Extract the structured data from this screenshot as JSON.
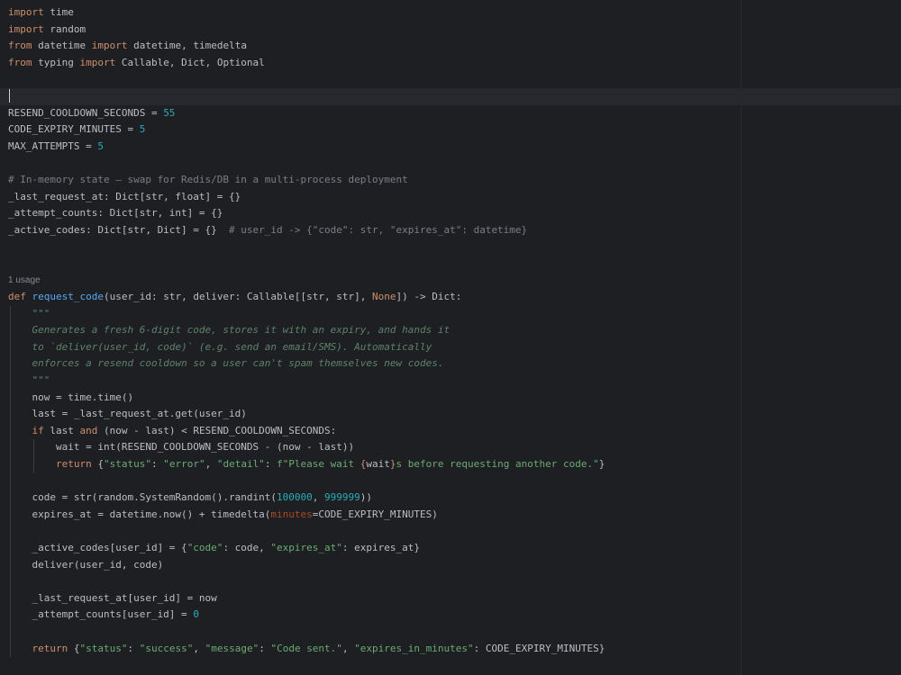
{
  "editor": {
    "language": "python",
    "theme_colors": {
      "background": "#1e1f22",
      "text": "#bcbec4",
      "keyword": "#cf8e6d",
      "number": "#2aacb8",
      "string": "#6aab73",
      "comment": "#7a7e85",
      "docstring": "#5f826b",
      "function_def": "#56a8f5",
      "named_argument": "#aa4926",
      "current_line": "#26282e",
      "usage_hint": "#868a91"
    },
    "usage_hint": "1 usage",
    "lines": [
      [
        {
          "type": "keyword",
          "text": "import"
        },
        {
          "type": "plain",
          "text": " time"
        }
      ],
      [
        {
          "type": "keyword",
          "text": "import"
        },
        {
          "type": "plain",
          "text": " random"
        }
      ],
      [
        {
          "type": "keyword",
          "text": "from"
        },
        {
          "type": "plain",
          "text": " datetime "
        },
        {
          "type": "keyword",
          "text": "import"
        },
        {
          "type": "plain",
          "text": " datetime, timedelta"
        }
      ],
      [
        {
          "type": "keyword",
          "text": "from"
        },
        {
          "type": "plain",
          "text": " typing "
        },
        {
          "type": "keyword",
          "text": "import"
        },
        {
          "type": "plain",
          "text": " Callable, Dict, Optional"
        }
      ],
      [],
      [
        {
          "type": "caret",
          "text": ""
        }
      ],
      [
        {
          "type": "plain",
          "text": "RESEND_COOLDOWN_SECONDS = "
        },
        {
          "type": "number",
          "text": "55"
        }
      ],
      [
        {
          "type": "plain",
          "text": "CODE_EXPIRY_MINUTES = "
        },
        {
          "type": "number",
          "text": "5"
        }
      ],
      [
        {
          "type": "plain",
          "text": "MAX_ATTEMPTS = "
        },
        {
          "type": "number",
          "text": "5"
        }
      ],
      [],
      [
        {
          "type": "comment",
          "text": "# In-memory state — swap for Redis/DB in a multi-process deployment"
        }
      ],
      [
        {
          "type": "plain",
          "text": "_last_request_at: Dict[str, float] = {}"
        }
      ],
      [
        {
          "type": "plain",
          "text": "_attempt_counts: Dict[str, int] = {}"
        }
      ],
      [
        {
          "type": "plain",
          "text": "_active_codes: Dict[str, Dict] = {}  "
        },
        {
          "type": "comment",
          "text": "# user_id -> {\"code\": str, \"expires_at\": datetime}"
        }
      ],
      [],
      [],
      [
        {
          "type": "hint",
          "text": "1 usage"
        }
      ],
      [
        {
          "type": "keyword",
          "text": "def"
        },
        {
          "type": "plain",
          "text": " "
        },
        {
          "type": "func-def",
          "text": "request_code"
        },
        {
          "type": "plain",
          "text": "(user_id: str, deliver: Callable[[str, str], "
        },
        {
          "type": "keyword",
          "text": "None"
        },
        {
          "type": "plain",
          "text": "]) -> Dict:"
        }
      ],
      [
        {
          "type": "plain",
          "text": "    "
        },
        {
          "type": "doc",
          "text": "\"\"\""
        }
      ],
      [
        {
          "type": "plain",
          "text": "    "
        },
        {
          "type": "doc",
          "text": "Generates a fresh 6-digit code, stores it with an expiry, and hands it"
        }
      ],
      [
        {
          "type": "plain",
          "text": "    "
        },
        {
          "type": "doc",
          "text": "to `deliver(user_id, code)` (e.g. send an email/SMS). Automatically"
        }
      ],
      [
        {
          "type": "plain",
          "text": "    "
        },
        {
          "type": "doc",
          "text": "enforces a resend cooldown so a user can't spam themselves new codes."
        }
      ],
      [
        {
          "type": "plain",
          "text": "    "
        },
        {
          "type": "doc",
          "text": "\"\"\""
        }
      ],
      [
        {
          "type": "plain",
          "text": "    now = time.time()"
        }
      ],
      [
        {
          "type": "plain",
          "text": "    last = _last_request_at.get(user_id)"
        }
      ],
      [
        {
          "type": "plain",
          "text": "    "
        },
        {
          "type": "keyword",
          "text": "if"
        },
        {
          "type": "plain",
          "text": " last "
        },
        {
          "type": "keyword",
          "text": "and"
        },
        {
          "type": "plain",
          "text": " (now - last) < RESEND_COOLDOWN_SECONDS:"
        }
      ],
      [
        {
          "type": "plain",
          "text": "        wait = int(RESEND_COOLDOWN_SECONDS - (now - last))"
        }
      ],
      [
        {
          "type": "plain",
          "text": "        "
        },
        {
          "type": "keyword",
          "text": "return"
        },
        {
          "type": "plain",
          "text": " {"
        },
        {
          "type": "string",
          "text": "\"status\""
        },
        {
          "type": "plain",
          "text": ": "
        },
        {
          "type": "string",
          "text": "\"error\""
        },
        {
          "type": "plain",
          "text": ", "
        },
        {
          "type": "string",
          "text": "\"detail\""
        },
        {
          "type": "plain",
          "text": ": "
        },
        {
          "type": "string",
          "text": "f\"Please wait "
        },
        {
          "type": "fstring-brace",
          "text": "{"
        },
        {
          "type": "plain",
          "text": "wait"
        },
        {
          "type": "fstring-brace",
          "text": "}"
        },
        {
          "type": "string",
          "text": "s before requesting another code.\""
        },
        {
          "type": "plain",
          "text": "}"
        }
      ],
      [],
      [
        {
          "type": "plain",
          "text": "    code = str(random.SystemRandom().randint("
        },
        {
          "type": "number",
          "text": "100000"
        },
        {
          "type": "plain",
          "text": ", "
        },
        {
          "type": "number",
          "text": "999999"
        },
        {
          "type": "plain",
          "text": "))"
        }
      ],
      [
        {
          "type": "plain",
          "text": "    expires_at = datetime.now() + timedelta("
        },
        {
          "type": "param",
          "text": "minutes"
        },
        {
          "type": "plain",
          "text": "=CODE_EXPIRY_MINUTES)"
        }
      ],
      [],
      [
        {
          "type": "plain",
          "text": "    _active_codes[user_id] = {"
        },
        {
          "type": "string",
          "text": "\"code\""
        },
        {
          "type": "plain",
          "text": ": code, "
        },
        {
          "type": "string",
          "text": "\"expires_at\""
        },
        {
          "type": "plain",
          "text": ": expires_at}"
        }
      ],
      [
        {
          "type": "plain",
          "text": "    deliver(user_id, code)"
        }
      ],
      [],
      [
        {
          "type": "plain",
          "text": "    _last_request_at[user_id] = now"
        }
      ],
      [
        {
          "type": "plain",
          "text": "    _attempt_counts[user_id] = "
        },
        {
          "type": "number",
          "text": "0"
        }
      ],
      [],
      [
        {
          "type": "plain",
          "text": "    "
        },
        {
          "type": "keyword",
          "text": "return"
        },
        {
          "type": "plain",
          "text": " {"
        },
        {
          "type": "string",
          "text": "\"status\""
        },
        {
          "type": "plain",
          "text": ": "
        },
        {
          "type": "string",
          "text": "\"success\""
        },
        {
          "type": "plain",
          "text": ", "
        },
        {
          "type": "string",
          "text": "\"message\""
        },
        {
          "type": "plain",
          "text": ": "
        },
        {
          "type": "string",
          "text": "\"Code sent.\""
        },
        {
          "type": "plain",
          "text": ", "
        },
        {
          "type": "string",
          "text": "\"expires_in_minutes\""
        },
        {
          "type": "plain",
          "text": ": CODE_EXPIRY_MINUTES}"
        }
      ]
    ]
  }
}
